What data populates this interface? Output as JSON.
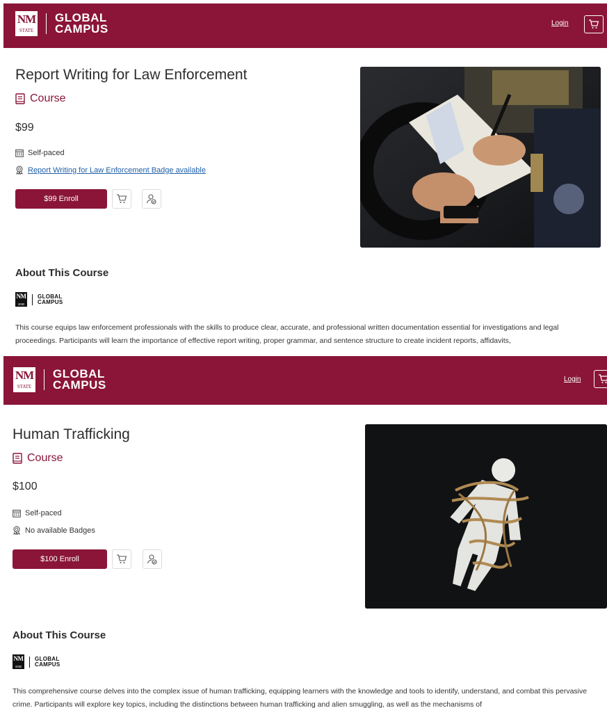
{
  "brand": {
    "logo_top": "NM",
    "logo_bottom": "STATE",
    "line1": "GLOBAL",
    "line2": "CAMPUS"
  },
  "header": {
    "login_label": "Login"
  },
  "colors": {
    "brand": "#8a1538",
    "link": "#1f5fa8"
  },
  "icons": {
    "cart": "cart-icon",
    "course": "course-book-icon",
    "pace": "calendar-icon",
    "badge": "badge-ribbon-icon",
    "share": "share-user-icon"
  },
  "courses": [
    {
      "title": "Report Writing for Law Enforcement",
      "type_label": "Course",
      "price": "$99",
      "pace": "Self-paced",
      "badge_text": "Report Writing for Law Enforcement Badge available",
      "badge_is_link": true,
      "enroll_label": "$99 Enroll",
      "about_heading": "About This Course",
      "description": "This course equips law enforcement professionals with the skills to produce clear, accurate, and professional written documentation essential for investigations and legal proceedings. Participants will learn the importance of effective report writing, proper grammar, and sentence structure to create incident reports, affidavits,"
    },
    {
      "title": "Human Trafficking",
      "type_label": "Course",
      "price": "$100",
      "pace": "Self-paced",
      "badge_text": "No available Badges",
      "badge_is_link": false,
      "enroll_label": "$100 Enroll",
      "about_heading": "About This Course",
      "description": "This comprehensive course delves into the complex issue of human trafficking, equipping learners with the knowledge and tools to identify, understand, and combat this pervasive crime. Participants will explore key topics, including the distinctions between human trafficking and alien smuggling, as well as the mechanisms of"
    }
  ]
}
